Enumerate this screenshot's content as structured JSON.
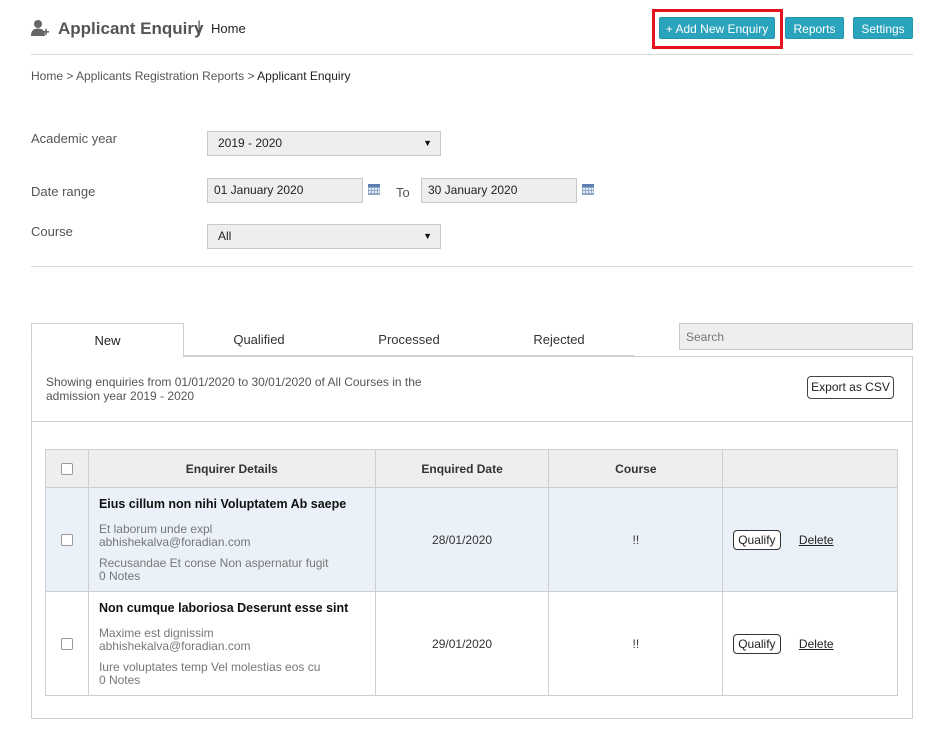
{
  "header": {
    "title": "Applicant Enquiry",
    "separator": "|",
    "home": "Home",
    "add_button": "+ Add New Enquiry",
    "reports_button": "Reports",
    "settings_button": "Settings",
    "accent_color": "#2aa3bd",
    "highlight_color": "#e3141e"
  },
  "breadcrumb": {
    "items": [
      "Home",
      "Applicants Registration Reports",
      "Applicant Enquiry"
    ],
    "separator": ">"
  },
  "filters": {
    "academic_year_label": "Academic year",
    "academic_year_value": "2019 - 2020",
    "date_range_label": "Date range",
    "date_from": "01 January 2020",
    "date_to_label": "To",
    "date_to": "30 January 2020",
    "course_label": "Course",
    "course_value": "All",
    "calendar_icon": "calendar-icon"
  },
  "tabs": [
    {
      "label": "New",
      "active": true
    },
    {
      "label": "Qualified",
      "active": false
    },
    {
      "label": "Processed",
      "active": false
    },
    {
      "label": "Rejected",
      "active": false
    }
  ],
  "search": {
    "placeholder": "Search"
  },
  "summary": {
    "text": "Showing enquiries from 01/01/2020 to 30/01/2020 of All Courses in the admission year 2019 - 2020",
    "export_button": "Export as CSV"
  },
  "table": {
    "columns": [
      "",
      "Enquirer Details",
      "Enquired Date",
      "Course",
      ""
    ],
    "rows": [
      {
        "name": "Eius cillum non nihi Voluptatem Ab saepe",
        "line1": "Et laborum unde expl",
        "email": "abhishekalva@foradian.com",
        "line3": "Recusandae Et conse Non aspernatur fugit",
        "notes": "0 Notes",
        "date": "28/01/2020",
        "course": "!!",
        "qualify": "Qualify",
        "delete": "Delete"
      },
      {
        "name": "Non cumque laboriosa Deserunt esse sint",
        "line1": "Maxime est dignissim",
        "email": "abhishekalva@foradian.com",
        "line3": "Iure voluptates temp Vel molestias eos cu",
        "notes": "0 Notes",
        "date": "29/01/2020",
        "course": "!!",
        "qualify": "Qualify",
        "delete": "Delete"
      }
    ]
  }
}
